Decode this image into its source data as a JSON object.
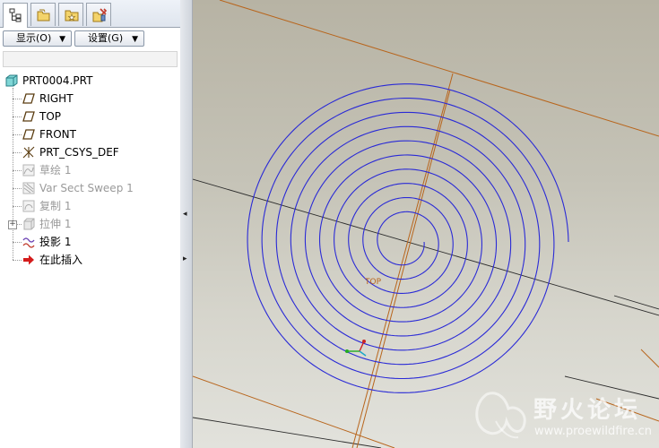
{
  "tabs": [
    {
      "name": "model-tree-tab",
      "icon": "model-tree-icon",
      "active": true
    },
    {
      "name": "folder-browser-tab",
      "icon": "folder-icon",
      "active": false
    },
    {
      "name": "favorites-tab",
      "icon": "favorites-icon",
      "active": false
    },
    {
      "name": "connections-tab",
      "icon": "connections-icon",
      "active": false
    }
  ],
  "toolbar": {
    "show_label": "显示(O)",
    "settings_label": "设置(G)"
  },
  "tree": {
    "root": "PRT0004.PRT",
    "items": [
      {
        "label": "RIGHT",
        "icon": "datum-plane-icon",
        "dim": false
      },
      {
        "label": "TOP",
        "icon": "datum-plane-icon",
        "dim": false
      },
      {
        "label": "FRONT",
        "icon": "datum-plane-icon",
        "dim": false
      },
      {
        "label": "PRT_CSYS_DEF",
        "icon": "csys-icon",
        "dim": false
      },
      {
        "label": "草绘 1",
        "icon": "sketch-icon",
        "dim": true
      },
      {
        "label": "Var Sect Sweep 1",
        "icon": "sweep-icon",
        "dim": true
      },
      {
        "label": "复制 1",
        "icon": "copy-icon",
        "dim": true
      },
      {
        "label": "拉伸 1",
        "icon": "extrude-icon",
        "dim": true
      },
      {
        "label": "投影 1",
        "icon": "projection-icon",
        "dim": false
      },
      {
        "label": "在此插入",
        "icon": "insert-here-arrow-icon",
        "dim": false
      }
    ]
  },
  "viewport": {
    "plane_label": "TOP",
    "colors": {
      "spiral": "#2a2ad6",
      "datum": "#b8651c",
      "edge": "#2b2b2b"
    }
  },
  "watermark": {
    "title": "野火论坛",
    "url": "www.proewildfire.cn"
  },
  "colors": {
    "panel_border": "#a9a9a9",
    "dim_text": "#9a9a9a",
    "insert_arrow": "#d41c1c"
  }
}
